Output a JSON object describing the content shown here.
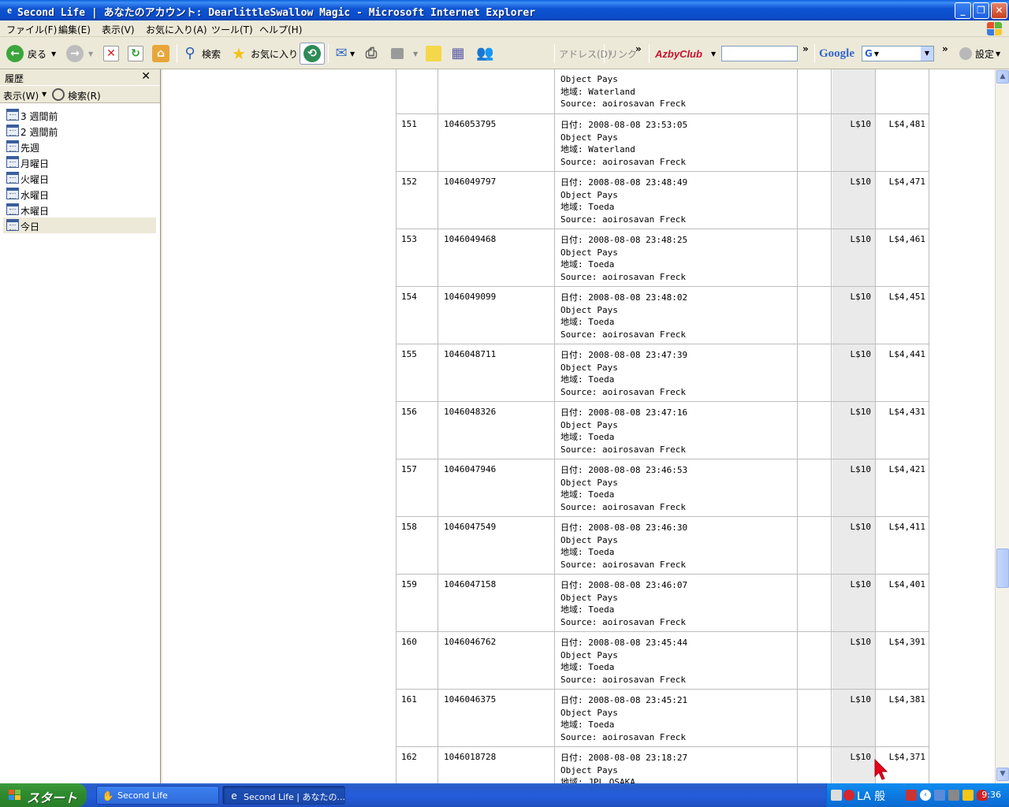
{
  "window": {
    "title": "Second Life | あなたのアカウント: DearlittleSwallow Magic - Microsoft Internet Explorer",
    "minimize": "_",
    "maximize": "❐",
    "close": "✕"
  },
  "menu": [
    "ファイル(F)",
    "編集(E)",
    "表示(V)",
    "お気に入り(A)",
    "ツール(T)",
    "ヘルプ(H)"
  ],
  "toolbar": {
    "back": "戻る",
    "search": "検索",
    "favorites": "お気に入り",
    "address": "アドレス(D)",
    "links": "リンク",
    "azby": "AzbyClub",
    "google": "Google",
    "google_g": "G",
    "settings": "設定",
    "more1": "»",
    "more2": "»",
    "more3": "»"
  },
  "history_pane": {
    "title": "履歴",
    "close": "✕",
    "view": "表示(W)",
    "search": "検索(R)",
    "items": [
      "3 週間前",
      "2 週間前",
      "先週",
      "月曜日",
      "火曜日",
      "水曜日",
      "木曜日",
      "今日"
    ],
    "selected_index": 7
  },
  "transactions": {
    "top_partial": {
      "line1": "Object Pays",
      "line2": "地域: Waterland",
      "line3": "Source: aoirosavan Freck"
    },
    "rows": [
      {
        "num": "151",
        "id": "1046053795",
        "date": "日付: 2008-08-08 23:53:05",
        "type": "Object Pays",
        "region": "地域: Waterland",
        "source": "Source: aoirosavan Freck",
        "amount": "L$10",
        "balance": "L$4,481"
      },
      {
        "num": "152",
        "id": "1046049797",
        "date": "日付: 2008-08-08 23:48:49",
        "type": "Object Pays",
        "region": "地域: Toeda",
        "source": "Source: aoirosavan Freck",
        "amount": "L$10",
        "balance": "L$4,471"
      },
      {
        "num": "153",
        "id": "1046049468",
        "date": "日付: 2008-08-08 23:48:25",
        "type": "Object Pays",
        "region": "地域: Toeda",
        "source": "Source: aoirosavan Freck",
        "amount": "L$10",
        "balance": "L$4,461"
      },
      {
        "num": "154",
        "id": "1046049099",
        "date": "日付: 2008-08-08 23:48:02",
        "type": "Object Pays",
        "region": "地域: Toeda",
        "source": "Source: aoirosavan Freck",
        "amount": "L$10",
        "balance": "L$4,451"
      },
      {
        "num": "155",
        "id": "1046048711",
        "date": "日付: 2008-08-08 23:47:39",
        "type": "Object Pays",
        "region": "地域: Toeda",
        "source": "Source: aoirosavan Freck",
        "amount": "L$10",
        "balance": "L$4,441"
      },
      {
        "num": "156",
        "id": "1046048326",
        "date": "日付: 2008-08-08 23:47:16",
        "type": "Object Pays",
        "region": "地域: Toeda",
        "source": "Source: aoirosavan Freck",
        "amount": "L$10",
        "balance": "L$4,431"
      },
      {
        "num": "157",
        "id": "1046047946",
        "date": "日付: 2008-08-08 23:46:53",
        "type": "Object Pays",
        "region": "地域: Toeda",
        "source": "Source: aoirosavan Freck",
        "amount": "L$10",
        "balance": "L$4,421"
      },
      {
        "num": "158",
        "id": "1046047549",
        "date": "日付: 2008-08-08 23:46:30",
        "type": "Object Pays",
        "region": "地域: Toeda",
        "source": "Source: aoirosavan Freck",
        "amount": "L$10",
        "balance": "L$4,411"
      },
      {
        "num": "159",
        "id": "1046047158",
        "date": "日付: 2008-08-08 23:46:07",
        "type": "Object Pays",
        "region": "地域: Toeda",
        "source": "Source: aoirosavan Freck",
        "amount": "L$10",
        "balance": "L$4,401"
      },
      {
        "num": "160",
        "id": "1046046762",
        "date": "日付: 2008-08-08 23:45:44",
        "type": "Object Pays",
        "region": "地域: Toeda",
        "source": "Source: aoirosavan Freck",
        "amount": "L$10",
        "balance": "L$4,391"
      },
      {
        "num": "161",
        "id": "1046046375",
        "date": "日付: 2008-08-08 23:45:21",
        "type": "Object Pays",
        "region": "地域: Toeda",
        "source": "Source: aoirosavan Freck",
        "amount": "L$10",
        "balance": "L$4,381"
      },
      {
        "num": "162",
        "id": "1046018728",
        "date": "日付: 2008-08-08 23:18:27",
        "type": "Object Pays",
        "region": "地域: JPL OSAKA",
        "source": "",
        "amount": "L$10",
        "balance": "L$4,371"
      }
    ]
  },
  "scrollbar": {
    "position": 0.72
  },
  "taskbar": {
    "start": "スタート",
    "tasks": [
      "Second Life",
      "Second Life | あなたの..."
    ],
    "ime": "LA 般",
    "clock": "9:36"
  },
  "colors": {
    "titlebar": "#0A4CC9",
    "start": "#2F8B2F",
    "taskbar": "#245DDB",
    "cursor": "#E8001C"
  }
}
